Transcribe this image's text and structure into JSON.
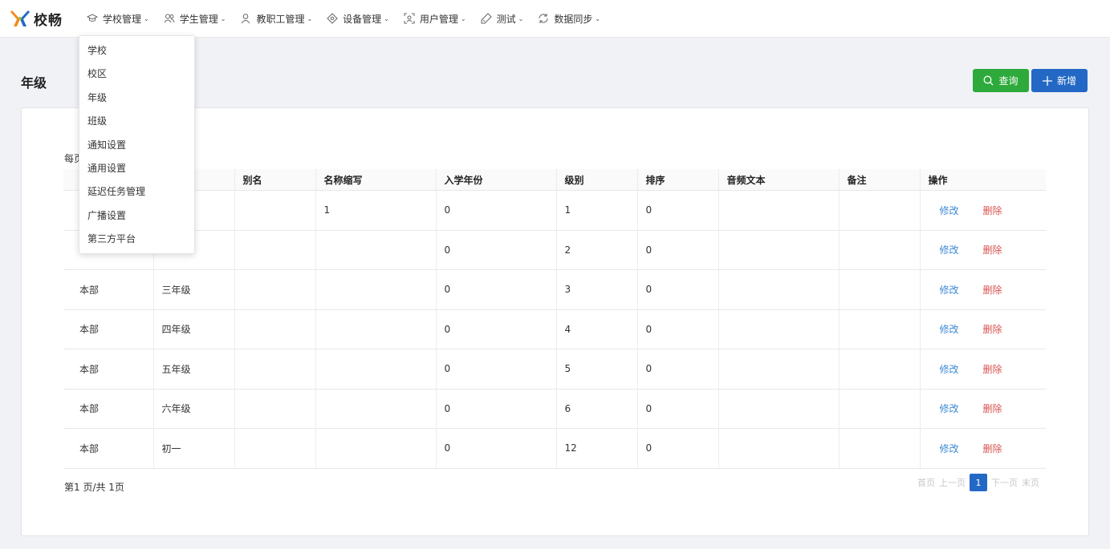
{
  "app": {
    "logo_text": "校畅",
    "brand_colors": {
      "orange": "#f28c1e",
      "blue": "#2468c5"
    }
  },
  "nav": {
    "items": [
      {
        "label": "学校管理",
        "icon": "graduation-cap-icon"
      },
      {
        "label": "学生管理",
        "icon": "users-icon"
      },
      {
        "label": "教职工管理",
        "icon": "user-icon"
      },
      {
        "label": "设备管理",
        "icon": "device-icon"
      },
      {
        "label": "用户管理",
        "icon": "user-scan-icon"
      },
      {
        "label": "测试",
        "icon": "test-icon"
      },
      {
        "label": "数据同步",
        "icon": "sync-icon"
      }
    ]
  },
  "dropdown": {
    "items": [
      "学校",
      "校区",
      "年级",
      "班级",
      "通知设置",
      "通用设置",
      "延迟任务管理",
      "广播设置",
      "第三方平台"
    ]
  },
  "page": {
    "title": "年级",
    "query_label": "查询",
    "add_label": "新增",
    "per_page_label": "每页"
  },
  "table": {
    "headers": [
      "",
      "",
      "别名",
      "名称缩写",
      "入学年份",
      "级别",
      "排序",
      "音频文本",
      "备注",
      "操作"
    ],
    "edit_label": "修改",
    "delete_label": "删除",
    "rows": [
      [
        "",
        "",
        "",
        "1",
        "0",
        "1",
        "0",
        "",
        ""
      ],
      [
        "",
        "",
        "",
        "",
        "0",
        "2",
        "0",
        "",
        ""
      ],
      [
        "本部",
        "三年级",
        "",
        "",
        "0",
        "3",
        "0",
        "",
        ""
      ],
      [
        "本部",
        "四年级",
        "",
        "",
        "0",
        "4",
        "0",
        "",
        ""
      ],
      [
        "本部",
        "五年级",
        "",
        "",
        "0",
        "5",
        "0",
        "",
        ""
      ],
      [
        "本部",
        "六年级",
        "",
        "",
        "0",
        "6",
        "0",
        "",
        ""
      ],
      [
        "本部",
        "初一",
        "",
        "",
        "0",
        "12",
        "0",
        "",
        ""
      ]
    ]
  },
  "pagination": {
    "info": "第1 页/共 1页",
    "first": "首页",
    "prev": "上一页",
    "current": "1",
    "next": "下一页",
    "last": "末页"
  }
}
